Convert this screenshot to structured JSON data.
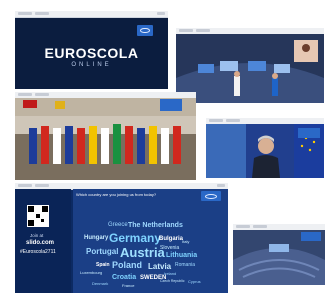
{
  "euroscola": {
    "title": "EUROSCOLA",
    "subtitle": "ONLINE"
  },
  "slido": {
    "join_prefix": "Join at",
    "url": "slido.com",
    "hashtag": "#Euroscola2711",
    "question": "Which country are you joining us from today?"
  },
  "word_cloud": [
    "Greece",
    "The Netherlands",
    "Hungary",
    "Germany",
    "Bulgaria",
    "Slovenia",
    "Portugal",
    "Austria",
    "Lithuania",
    "Poland",
    "Latvia",
    "Romania",
    "Spain",
    "Croatia",
    "SWEDEN",
    "Luxembourg",
    "Ireland",
    "Czech Republic",
    "Denmark",
    "France",
    "Italy",
    "Cyprus"
  ],
  "colors": {
    "dark_navy": "#0b1d3f",
    "ep_blue": "#2a68c7",
    "wordcloud_bg": "#1b3f86",
    "germany": "#7fd3ff",
    "austria": "#9fe0ff"
  }
}
